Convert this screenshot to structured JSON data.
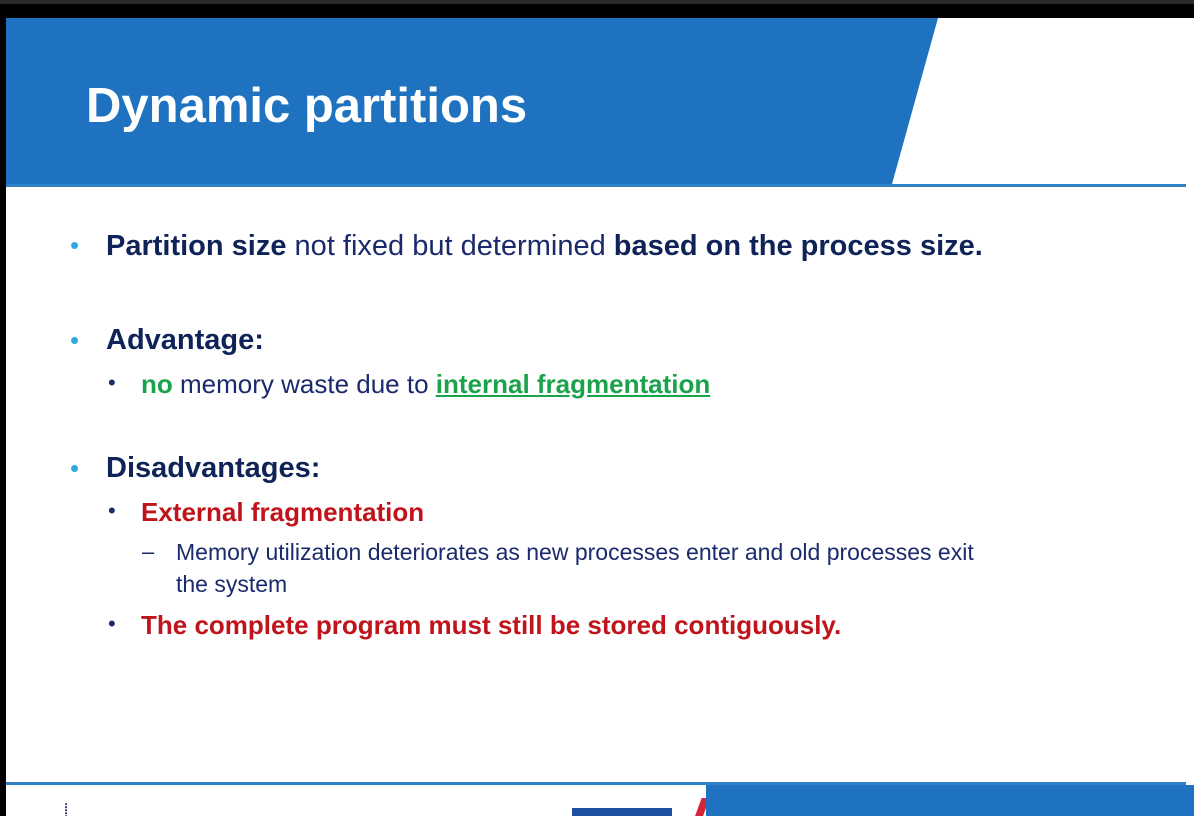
{
  "slide": {
    "title": "Dynamic partitions",
    "bullets": {
      "b1": {
        "part1": "Partition size",
        "part2": " not fixed but determined ",
        "part3": "based on the process size."
      },
      "advantage": {
        "label": "Advantage:",
        "sub_no": "no",
        "sub_mid": " memory waste due to ",
        "sub_link": "internal fragmentation"
      },
      "disadvantages": {
        "label": "Disadvantages:",
        "ext": "External fragmentation",
        "ext_detail_line1": "Memory utilization deteriorates as new processes enter and old processes exit",
        "ext_detail_line2": "the system",
        "contig": "The complete program must still be stored contiguously."
      }
    },
    "colors": {
      "header_blue": "#1f72bf",
      "navy_text": "#0f2358",
      "green": "#1aa34a",
      "red": "#c0141c",
      "bullet_cyan": "#2fa8e0"
    }
  },
  "icons": {
    "bullet": "bullet-dot-icon",
    "dash": "dash-icon",
    "footer_left": "tree-logo-icon",
    "footer_mid": "university-logo-icon"
  }
}
